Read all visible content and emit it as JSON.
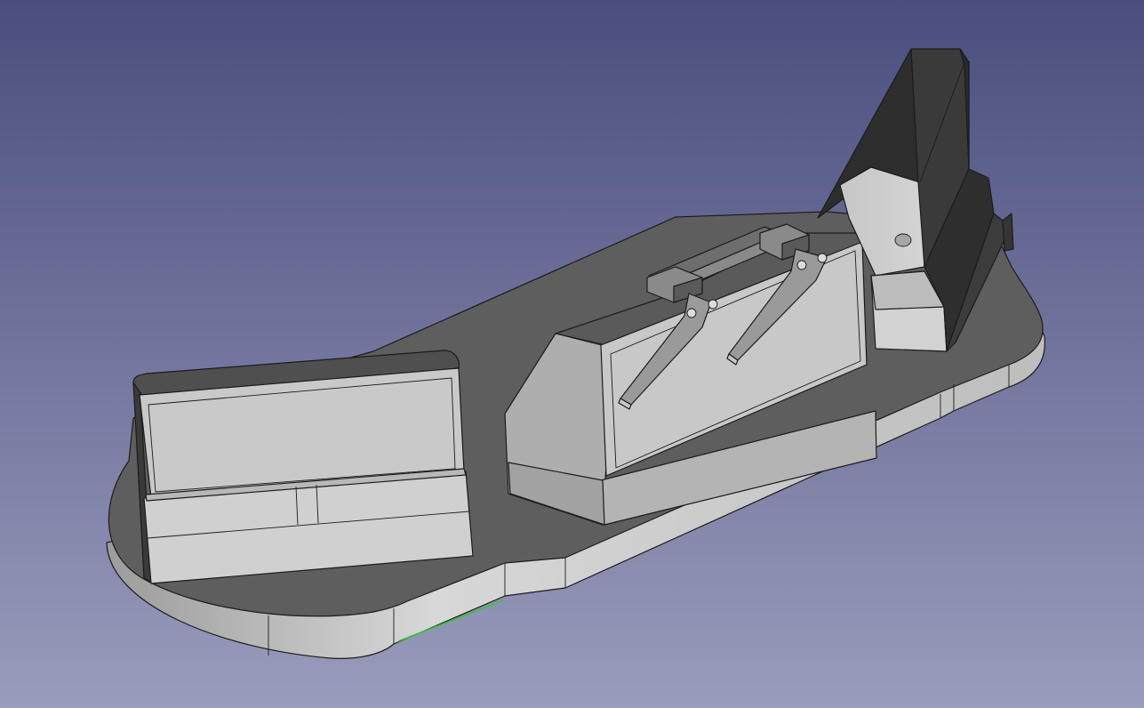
{
  "viewport": {
    "background_top": "#4a4e7e",
    "background_bottom": "#9a9cbc"
  },
  "model": {
    "face_colors": {
      "top": "#5e5e5e",
      "side_light": "#c9c9c9",
      "side_mid": "#a8a8a8",
      "side_dark": "#2c2c2c",
      "edge": "#1b1b1b"
    },
    "selected_edge_color": "#32c832"
  }
}
